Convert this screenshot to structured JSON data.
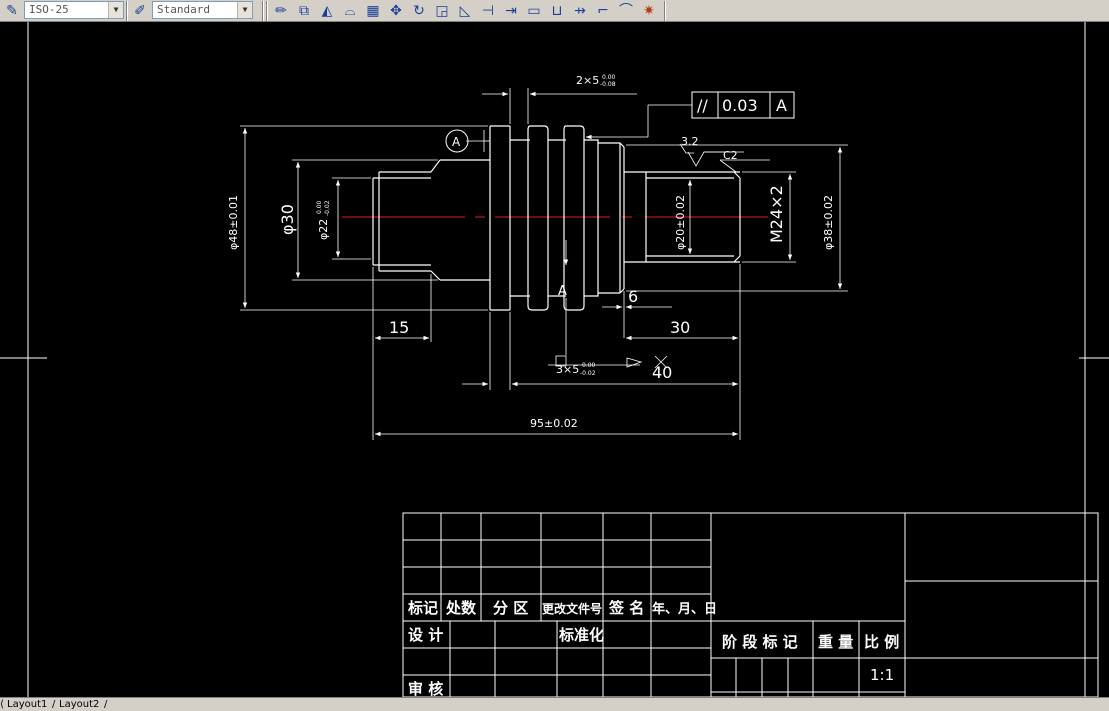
{
  "toolbar": {
    "dimstyle_icon": "dimension-style-icon",
    "dimstyle_value": "ISO-25",
    "textstyle_icon": "text-style-icon",
    "textstyle_value": "Standard",
    "tools": [
      "erase-icon",
      "copy-icon",
      "mirror-icon",
      "offset-icon",
      "array-icon",
      "move-icon",
      "rotate-icon",
      "scale-icon",
      "stretch-icon",
      "trim-icon",
      "extend-icon",
      "break-icon",
      "join-icon",
      "chamfer-icon",
      "fillet-icon",
      "explode-icon"
    ]
  },
  "drawing": {
    "dim_groove": "2×5",
    "dim_groove_tol_upper": "0.00",
    "dim_groove_tol_lower": "-0.08",
    "gdt_symbol": "//",
    "gdt_tolerance": "0.03",
    "gdt_datum": "A",
    "datum_label": "A",
    "datum_triangle_label": "A",
    "roughness": "3.2",
    "chamfer": "C2",
    "dia_48": "φ48±0.01",
    "dia_30": "φ30",
    "dia_22": "φ22",
    "dia_22_tol_upper": "0.00",
    "dia_22_tol_lower": "-0.02",
    "dia_20": "φ20±0.02",
    "thread": "M24×2",
    "dia_38": "φ38±0.02",
    "len_15": "15",
    "len_6": "6",
    "len_30": "30",
    "len_40": "40",
    "dim_slot": "3×5",
    "dim_slot_tol_upper": "0.00",
    "dim_slot_tol_lower": "-0.02",
    "len_total": "95±0.02"
  },
  "titleblock": {
    "h_mark": "标记",
    "h_count": "处数",
    "h_zone": "分 区",
    "h_docno": "更改文件号",
    "h_sign": "签 名",
    "h_date": "年、月、日",
    "r_design": "设 计",
    "r_standard": "标准化",
    "r_review": "审 核",
    "stage_mark": "阶 段 标 记",
    "weight": "重 量",
    "scale_label": "比 例",
    "scale_value": "1:1"
  },
  "tabs": {
    "layout1": "Layout1",
    "layout2": "Layout2"
  }
}
